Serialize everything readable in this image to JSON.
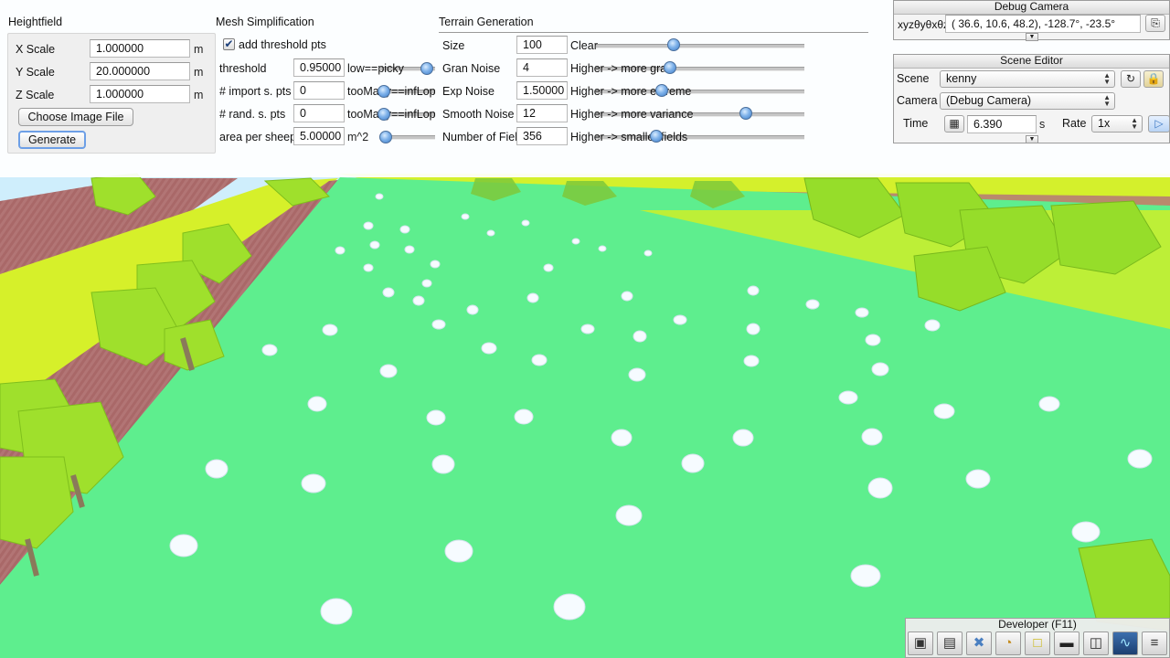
{
  "heightfield": {
    "title": "Heightfield",
    "x_label": "X Scale",
    "x_value": "1.000000",
    "x_unit": "m",
    "y_label": "Y Scale",
    "y_value": "20.000000",
    "y_unit": "m",
    "z_label": "Z Scale",
    "z_value": "1.000000",
    "z_unit": "m",
    "choose_label": "Choose Image File",
    "generate_label": "Generate"
  },
  "mesh": {
    "title": "Mesh Simplification",
    "add_threshold_label": "add threshold pts",
    "add_threshold_checked": true,
    "threshold_label": "threshold",
    "threshold_value": "0.95000",
    "threshold_hint": "low==picky",
    "import_label": "# import s. pts",
    "import_value": "0",
    "import_hint": "tooMany==infLop",
    "rand_label": "# rand. s. pts",
    "rand_value": "0",
    "rand_hint": "tooMany==infLop",
    "area_label": "area per sheep",
    "area_value": "5.00000",
    "area_unit": "m^2"
  },
  "terrain": {
    "title": "Terrain Generation",
    "size_label": "Size",
    "size_value": "100",
    "size_hint": "Clear",
    "gran_label": "Gran Noise",
    "gran_value": "4",
    "gran_hint": "Higher -> more gran",
    "exp_label": "Exp Noise",
    "exp_value": "1.50000",
    "exp_hint": "Higher -> more extreme",
    "smooth_label": "Smooth Noise",
    "smooth_value": "12",
    "smooth_hint": "Higher -> more variance",
    "fields_label": "Number of Fields",
    "fields_value": "356",
    "fields_hint": "Higher -> smaller fields"
  },
  "debug_camera": {
    "title": "Debug Camera",
    "axis_label": "xyzθyθxθz",
    "coords": "( 36.6,  10.6,  48.2), -128.7°, -23.5°"
  },
  "scene_editor": {
    "title": "Scene Editor",
    "scene_label": "Scene",
    "scene_value": "kenny",
    "camera_label": "Camera",
    "camera_value": "(Debug Camera)",
    "time_label": "Time",
    "time_value": "6.390",
    "time_unit": "s",
    "rate_label": "Rate",
    "rate_value": "1x"
  },
  "developer": {
    "title": "Developer (F11)",
    "tools": [
      {
        "name": "camera",
        "glyph": "▣"
      },
      {
        "name": "clapper",
        "glyph": "▤"
      },
      {
        "name": "tools",
        "glyph": "✖"
      },
      {
        "name": "clock",
        "glyph": "◔"
      },
      {
        "name": "note",
        "glyph": "□"
      },
      {
        "name": "console",
        "glyph": "▬"
      },
      {
        "name": "windows",
        "glyph": "◫"
      },
      {
        "name": "graph",
        "glyph": "∿"
      },
      {
        "name": "page",
        "glyph": "≡"
      }
    ]
  },
  "colors": {
    "grass": "#5fee8e",
    "yellow_strip": "#d8f02a",
    "dirt_path": "#b37777",
    "sky": "#c9efff",
    "slider_knob": "#5a98dc"
  }
}
